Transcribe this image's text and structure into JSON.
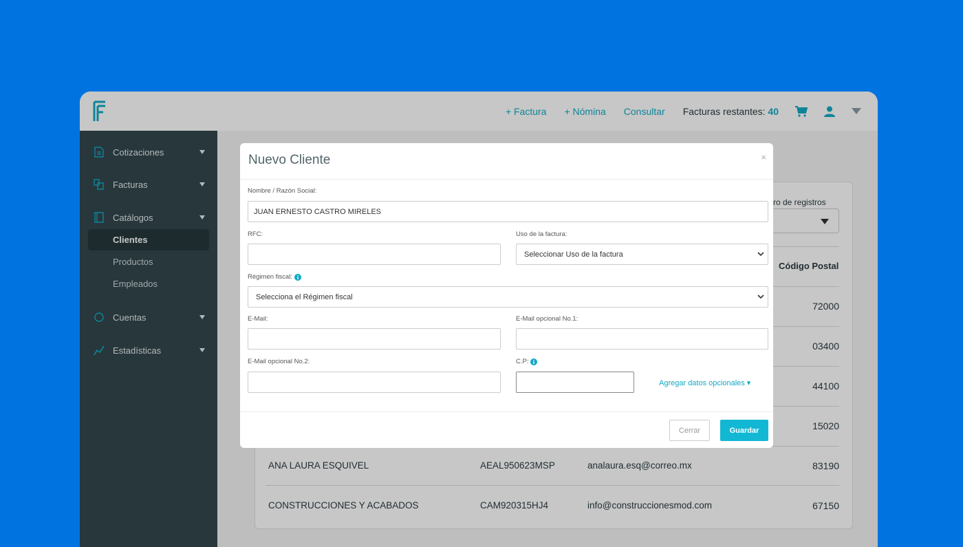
{
  "topbar": {
    "factura_link": "+ Factura",
    "nomina_link": "+ Nómina",
    "consultar_link": "Consultar",
    "remaining_label": "Facturas restantes:",
    "remaining_count": "40",
    "accent": "#12a9c4"
  },
  "sidebar": {
    "cotizaciones": "Cotizaciones",
    "facturas": "Facturas",
    "catalogos": "Catálogos",
    "clientes": "Clientes",
    "productos": "Productos",
    "empleados": "Empleados",
    "cuentas": "Cuentas",
    "estadisticas": "Estadísticas"
  },
  "background": {
    "registros_label": "ro de registros",
    "cp_header": "Código Postal",
    "postal_codes": [
      "72000",
      "03400",
      "44100",
      "15020"
    ],
    "rows": [
      {
        "name": "ANA LAURA ESQUIVEL",
        "rfc": "AEAL950623MSP",
        "email": "analaura.esq@correo.mx",
        "cp": "83190"
      },
      {
        "name": "CONSTRUCCIONES Y ACABADOS",
        "rfc": "CAM920315HJ4",
        "email": "info@construccionesmod.com",
        "cp": "67150"
      }
    ]
  },
  "modal": {
    "title": "Nuevo Cliente",
    "close_symbol": "×",
    "nombre_label": "Nombre / Razón Social:",
    "nombre_value": "JUAN ERNESTO CASTRO MIRELES",
    "rfc_label": "RFC:",
    "rfc_value": "",
    "uso_label": "Uso de la factura:",
    "uso_value": "Seleccionar Uso de la factura",
    "regimen_label": "Régimen fiscal:",
    "regimen_value": "Selecciona el Régimen fiscal",
    "email_label": "E-Mail:",
    "email_value": "",
    "email1_label": "E-Mail opcional No.1:",
    "email1_value": "",
    "email2_label": "E-Mail opcional No.2:",
    "email2_value": "",
    "cp_label": "C.P:",
    "cp_value": "",
    "optional_link": "Agregar datos opcionales ▾",
    "cerrar": "Cerrar",
    "guardar": "Guardar"
  }
}
